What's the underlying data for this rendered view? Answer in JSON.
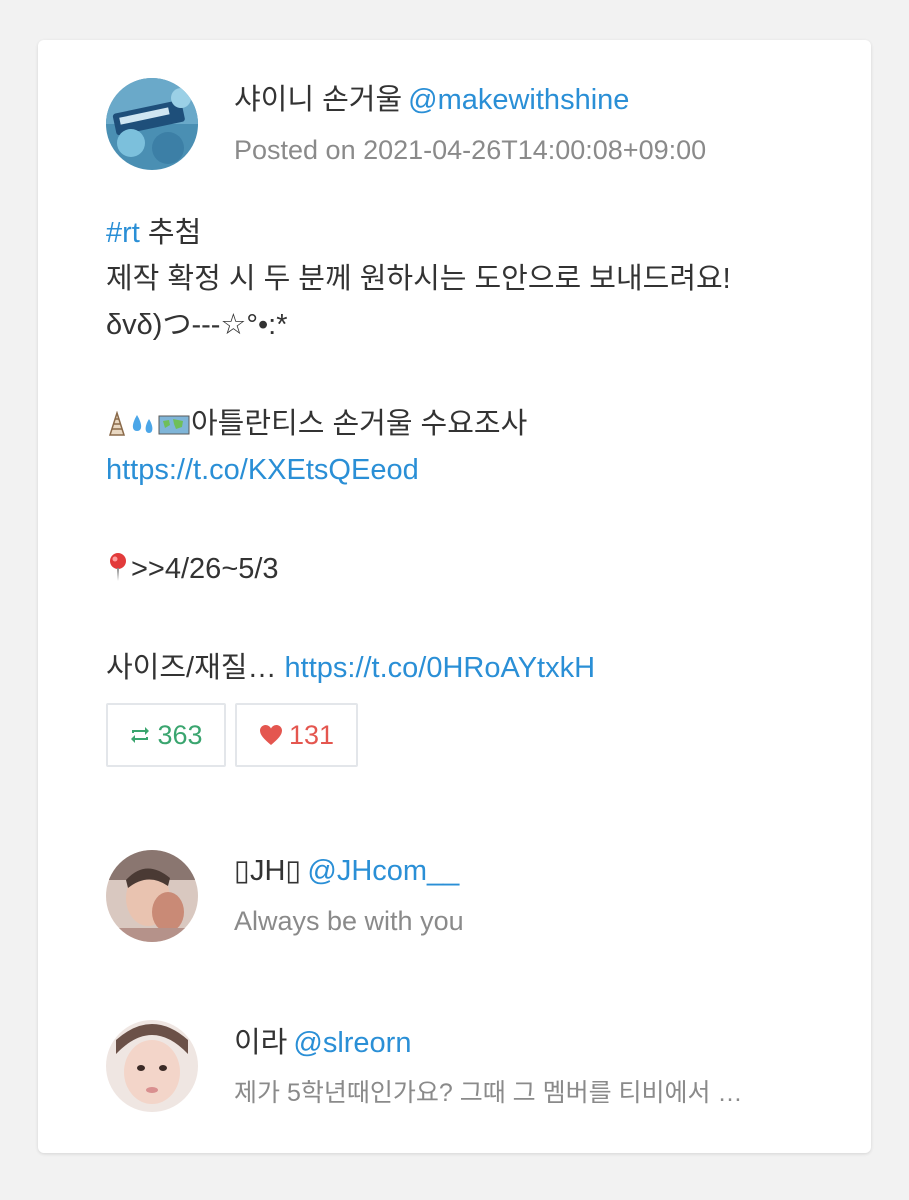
{
  "post": {
    "author_name": "샤이니 손거울",
    "author_handle": "@makewithshine",
    "posted": "Posted on 2021-04-26T14:00:08+09:00",
    "hashtag": "#rt",
    "line1_rest": " 추첨",
    "line2": "제작 확정 시 두 분께 원하시는 도안으로 보내드려요!",
    "line3": "δvδ)つ---☆°•:*",
    "line4_text": "아틀란티스 손거울 수요조사",
    "link1": "https://t.co/KXEtsQEeod",
    "line5_text": ">>4/26~5/3",
    "line6_text": "사이즈/재질… ",
    "link2": "https://t.co/0HRoAYtxkH",
    "retweets": "363",
    "likes": "131"
  },
  "replies": [
    {
      "name": "▯JH▯",
      "handle": "@JHcom__",
      "text": "Always be with you"
    },
    {
      "name": "이라",
      "handle": "@slreorn",
      "text": "제가 5학년때인가요? 그때 그 멤버를 티비에서 …"
    }
  ],
  "icons": {
    "retweet": "retweet-icon",
    "like": "heart-icon",
    "pin": "round-pushpin-emoji",
    "shell": "spiral-shell-emoji",
    "droplets": "sweat-droplets-emoji",
    "map": "world-map-emoji"
  },
  "colors": {
    "link": "#2a8fd6",
    "retweet": "#3aa56f",
    "like": "#e4564f",
    "muted": "#8a8a8a"
  }
}
